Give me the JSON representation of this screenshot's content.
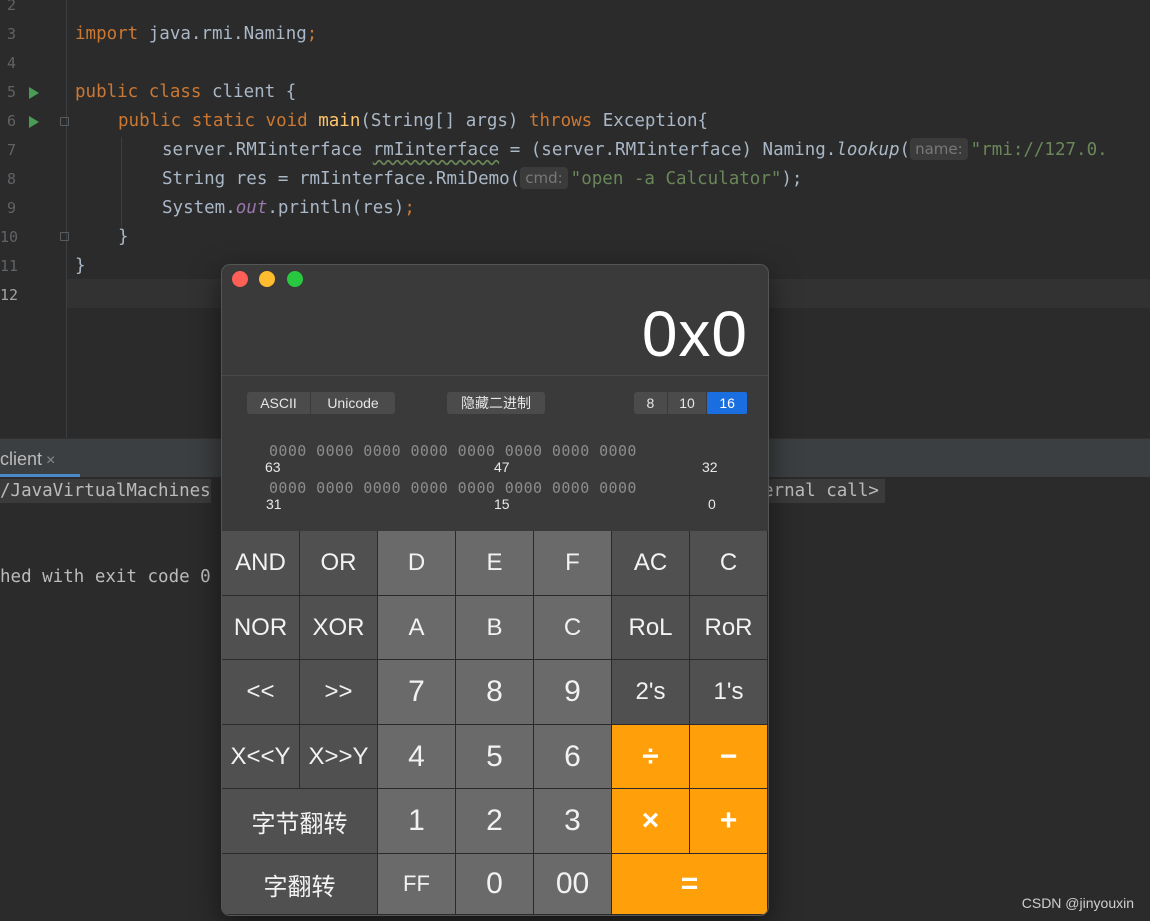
{
  "editor": {
    "line_numbers": [
      "2",
      "3",
      "4",
      "5",
      "6",
      "7",
      "8",
      "9",
      "10",
      "11",
      "12"
    ],
    "code": {
      "l3": {
        "kw": "import",
        "rest": " java.rmi.Naming",
        "semi": ";"
      },
      "l5": {
        "kw1": "public",
        "kw2": "class",
        "rest": " client {"
      },
      "l6": {
        "kw1": "public",
        "kw2": "static",
        "kw3": "void",
        "fn": "main",
        "mid": "(String[] args) ",
        "kw4": "throws",
        "rest": " Exception{"
      },
      "l7": {
        "a": "server.RMIinterface ",
        "b": "rmIinterface",
        "c": " = (server.RMIinterface) Naming.",
        "d": "lookup",
        "e": "(",
        "hint": "name:",
        "str": "\"rmi://127.0."
      },
      "l8": {
        "a": "String res = rmIinterface.RmiDemo(",
        "hint": "cmd:",
        "str": "\"open -a Calculator\"",
        "e": ");"
      },
      "l9": {
        "a": "System.",
        "stat": "out",
        "b": ".println(res)",
        "semi": ";"
      },
      "l10": {
        "a": "}"
      },
      "l11": {
        "a": "}"
      }
    }
  },
  "run_panel": {
    "tab_label": "client",
    "tab_close": "×",
    "line1_left": "/JavaVirtualMachines",
    "line1_right": "ernal call>",
    "line2": "hed with exit code 0"
  },
  "calculator": {
    "display": "0x0",
    "encoding_toggle": [
      "ASCII",
      "Unicode"
    ],
    "hide_binary_label": "隐藏二进制",
    "base_toggle": [
      "8",
      "10",
      "16"
    ],
    "selected_base": "16",
    "bit_rows": [
      {
        "bits": "0000 0000 0000 0000 0000 0000 0000 0000",
        "left": "63",
        "mid": "47",
        "right": "32"
      },
      {
        "bits": "0000 0000 0000 0000 0000 0000 0000 0000",
        "left": "31",
        "mid": "15",
        "right": "0"
      }
    ],
    "keys": {
      "r1": [
        "AND",
        "OR",
        "D",
        "E",
        "F",
        "AC",
        "C"
      ],
      "r2": [
        "NOR",
        "XOR",
        "A",
        "B",
        "C",
        "RoL",
        "RoR"
      ],
      "r3": [
        "<<",
        ">>",
        "7",
        "8",
        "9",
        "2's",
        "1's"
      ],
      "r4": [
        "X<<Y",
        "X>>Y",
        "4",
        "5",
        "6",
        "÷",
        "−"
      ],
      "r5": [
        "字节翻转",
        "1",
        "2",
        "3",
        "×",
        "+"
      ],
      "r6": [
        "字翻转",
        "FF",
        "0",
        "00",
        "="
      ]
    }
  },
  "watermark": "CSDN @jinyouxin",
  "colors": {
    "accent_blue": "#1b6ee0",
    "operator_orange": "#ff9f0a"
  }
}
